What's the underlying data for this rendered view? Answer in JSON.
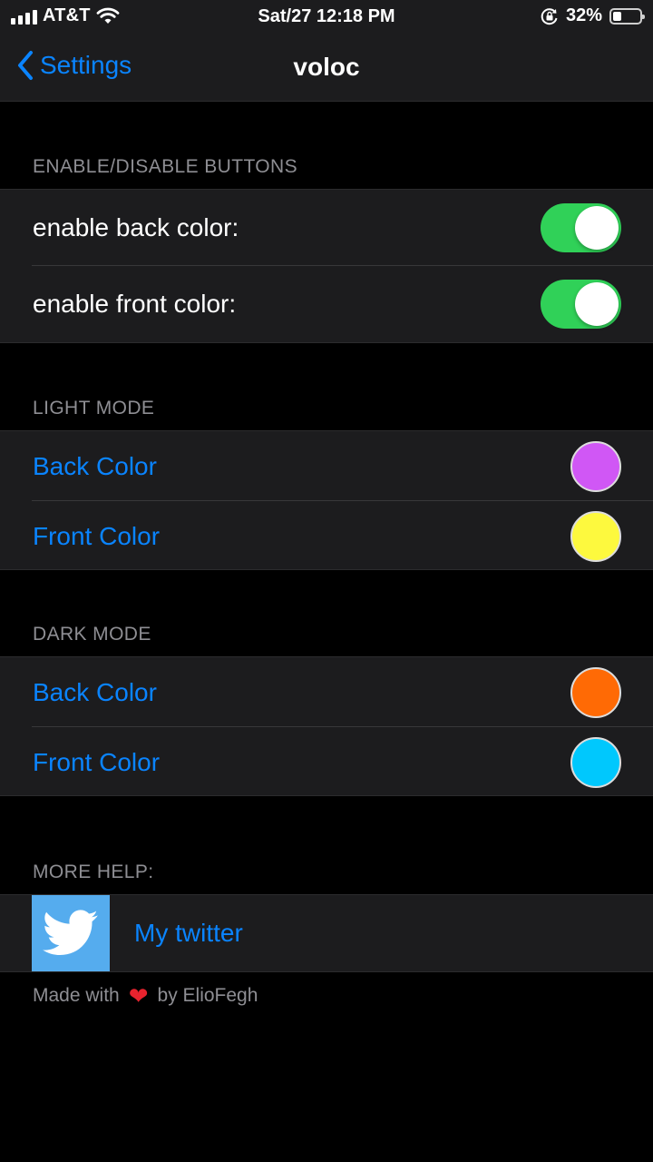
{
  "status_bar": {
    "carrier": "AT&T",
    "time": "Sat/27 12:18 PM",
    "battery_percent": "32%",
    "battery_level": 0.32,
    "icons": [
      "signal-icon",
      "wifi-icon",
      "orientation-lock-icon",
      "battery-icon"
    ]
  },
  "nav": {
    "back_label": "Settings",
    "title": "voloc"
  },
  "sections": {
    "buttons": {
      "header": "ENABLE/DISABLE BUTTONS",
      "rows": [
        {
          "label": "enable back color:",
          "on": true
        },
        {
          "label": "enable front color:",
          "on": true
        }
      ]
    },
    "light_mode": {
      "header": "LIGHT MODE",
      "rows": [
        {
          "label": "Back Color",
          "color": "#d057f5"
        },
        {
          "label": "Front Color",
          "color": "#fdf93e"
        }
      ]
    },
    "dark_mode": {
      "header": "DARK MODE",
      "rows": [
        {
          "label": "Back Color",
          "color": "#ff6a05"
        },
        {
          "label": "Front Color",
          "color": "#00c8fd"
        }
      ]
    },
    "help": {
      "header": "MORE HELP:",
      "twitter_label": "My twitter"
    }
  },
  "footer": {
    "prefix": "Made with",
    "suffix": "by ElioFegh"
  },
  "colors": {
    "accent": "#0a84ff",
    "toggle_on": "#30d158",
    "twitter_blue": "#55acee",
    "heart": "#e8232e"
  }
}
